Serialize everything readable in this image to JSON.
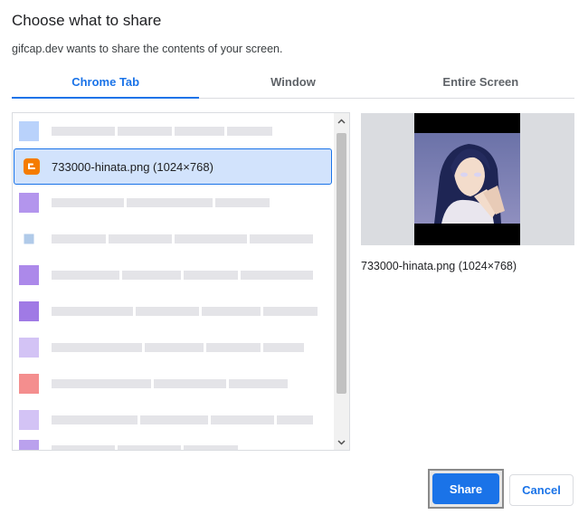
{
  "dialog": {
    "title": "Choose what to share",
    "subtitle": "gifcap.dev wants to share the contents of your screen."
  },
  "tabs": [
    {
      "label": "Chrome Tab",
      "active": true
    },
    {
      "label": "Window",
      "active": false
    },
    {
      "label": "Entire Screen",
      "active": false
    }
  ],
  "tab_list": {
    "selected_item": {
      "label": "733000-hinata.png (1024×768)",
      "icon": "blogger-icon",
      "icon_color": "#f57c00"
    },
    "blurred_items": [
      {
        "icon_color": "#a8c7fa"
      },
      {
        "icon_color": "#a07be8"
      },
      {
        "icon_color": "#8fb4e0"
      },
      {
        "icon_color": "#9d74e6"
      },
      {
        "icon_color": "#8f63e0"
      },
      {
        "icon_color": "#c8b4f2"
      },
      {
        "icon_color": "#f27a7a"
      },
      {
        "icon_color": "#c8b4f2"
      },
      {
        "icon_color": "#a98ae8"
      }
    ]
  },
  "preview": {
    "label": "733000-hinata.png (1024×768)"
  },
  "buttons": {
    "share": "Share",
    "cancel": "Cancel"
  },
  "colors": {
    "accent": "#1a73e8",
    "selected_bg": "#d2e3fc"
  }
}
